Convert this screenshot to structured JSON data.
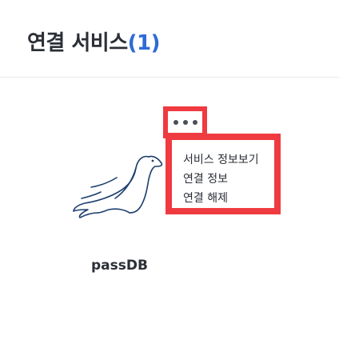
{
  "header": {
    "title": "연결 서비스",
    "count": "(1)"
  },
  "service_card": {
    "name": "passDB",
    "logo_icon": "mariadb-seal-icon",
    "more_icon": "more-dots-icon",
    "menu": {
      "items": [
        {
          "label": "서비스 정보보기"
        },
        {
          "label": "연결 정보"
        },
        {
          "label": "연결 해제"
        }
      ]
    }
  },
  "colors": {
    "accent": "#2e6bd6",
    "highlight": "#ef3b40",
    "text": "#2b2f36",
    "logo": "#1c3f6e"
  }
}
